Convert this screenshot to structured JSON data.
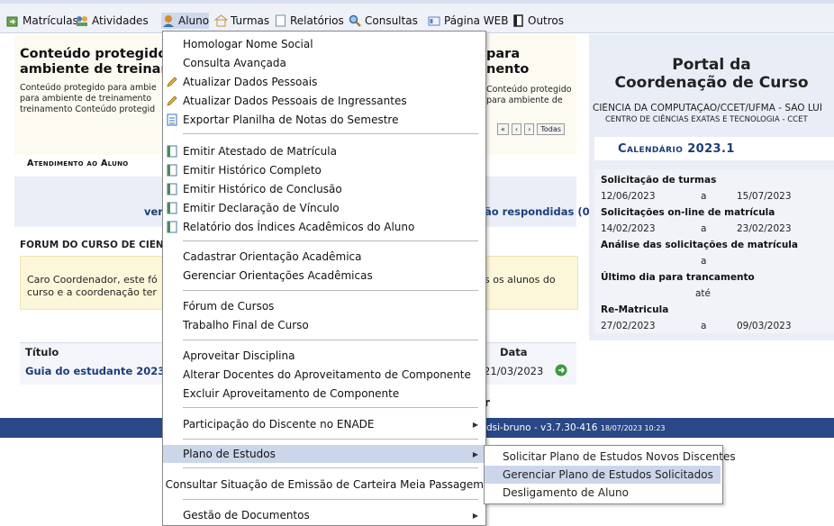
{
  "menubar": {
    "items": [
      {
        "label": "Matrículas",
        "icon": "matriculas-icon"
      },
      {
        "label": "Atividades",
        "icon": "atividades-icon"
      },
      {
        "label": "Aluno",
        "icon": "aluno-icon"
      },
      {
        "label": "Turmas",
        "icon": "turmas-icon"
      },
      {
        "label": "Relatórios",
        "icon": "relatorios-icon"
      },
      {
        "label": "Consultas",
        "icon": "search-icon"
      },
      {
        "label": "Página WEB",
        "icon": "web-icon"
      },
      {
        "label": "Outros",
        "icon": "outros-icon"
      }
    ]
  },
  "left": {
    "title_line1": "Conteúdo protegido p",
    "title_line1_right": "para",
    "title_line2": "ambiente de treiname",
    "title_line2_right": "nento",
    "body_line1": "Conteúdo protegido para ambie",
    "body_line1_right": "Conteúdo protegido",
    "body_line2": "para ambiente de treinamento",
    "body_line2_right": "para ambiente de",
    "body_line3": "treinamento Conteúdo protegid",
    "pager": [
      "«",
      "‹",
      "›",
      "Todas"
    ],
    "atendimento_title": "Atendimento ao Aluno",
    "ver_text": "ver",
    "nao_respondidas": "ão respondidas (0)",
    "forum_title": "FÓRUM DO CURSO DE CIÊN",
    "forum_msg_line1": "Caro Coordenador, este fó",
    "forum_msg_line1_right": "s os alunos do",
    "forum_msg_line2": "curso e a coordenação ter",
    "table": {
      "col_titulo": "Título",
      "col_data": "Data",
      "row_titulo": "Guia do estudante 2023",
      "row_data": "21/03/2023"
    },
    "footer_r": "r",
    "footer_text": "dsi-bruno - v3.7.30-416",
    "footer_date": "18/07/2023 10:23"
  },
  "menu": {
    "items": [
      {
        "label": "Homologar Nome Social",
        "icon": ""
      },
      {
        "label": "Consulta Avançada",
        "icon": ""
      },
      {
        "label": "Atualizar Dados Pessoais",
        "icon": "pencil-icon"
      },
      {
        "label": "Atualizar Dados Pessoais de Ingressantes",
        "icon": "pencil-icon"
      },
      {
        "label": "Exportar Planilha de Notas do Semestre",
        "icon": "spreadsheet-icon"
      },
      {
        "label": "Emitir Atestado de Matrícula",
        "icon": "document-icon"
      },
      {
        "label": "Emitir Histórico Completo",
        "icon": "document-icon"
      },
      {
        "label": "Emitir Histórico de Conclusão",
        "icon": "document-icon"
      },
      {
        "label": "Emitir Declaração de Vínculo",
        "icon": "document-icon"
      },
      {
        "label": "Relatório dos Índices Acadêmicos do Aluno",
        "icon": "document-icon"
      },
      {
        "label": "Cadastrar Orientação Acadêmica",
        "icon": ""
      },
      {
        "label": "Gerenciar Orientações Acadêmicas",
        "icon": ""
      },
      {
        "label": "Fórum de Cursos",
        "icon": ""
      },
      {
        "label": "Trabalho Final de Curso",
        "icon": ""
      },
      {
        "label": "Aproveitar Disciplina",
        "icon": ""
      },
      {
        "label": "Alterar Docentes do Aproveitamento de Componente",
        "icon": ""
      },
      {
        "label": "Excluir Aproveitamento de Componente",
        "icon": ""
      },
      {
        "label": "Participação do Discente no ENADE",
        "icon": ""
      },
      {
        "label": "Plano de Estudos",
        "icon": ""
      },
      {
        "label": "Consultar Situação de Emissão de Carteira Meia Passagem",
        "icon": ""
      },
      {
        "label": "Gestão de Documentos",
        "icon": ""
      }
    ]
  },
  "submenu": {
    "items": [
      {
        "label": "Solicitar Plano de Estudos Novos Discentes"
      },
      {
        "label": "Gerenciar Plano de Estudos Solicitados"
      },
      {
        "label": "Desligamento de Aluno"
      }
    ]
  },
  "portal": {
    "title_line1": "Portal da",
    "title_line2": "Coordenação de Curso",
    "course": "CIÊNCIA DA COMPUTAÇÃO/CCET/UFMA - SÃO LUÍ",
    "center": "CENTRO DE CIÊNCIAS EXATAS E TECNOLOGIA - CCET",
    "calendar_title": "Calendário 2023.1",
    "calendar": [
      {
        "label": "Solicitação de turmas",
        "start": "12/06/2023",
        "sep": "a",
        "end": "15/07/2023"
      },
      {
        "label": "Solicitações on-line de matrícula",
        "start": "14/02/2023",
        "sep": "a",
        "end": "23/02/2023"
      },
      {
        "label": "Análise das solicitações de matrícula",
        "start": "",
        "sep": "a",
        "end": ""
      },
      {
        "label": "Último dia para trancamento",
        "start": "",
        "sep": "até",
        "end": ""
      },
      {
        "label": "Re-Matricula",
        "start": "27/02/2023",
        "sep": "a",
        "end": "09/03/2023"
      }
    ]
  },
  "colors": {
    "menubar_bg": "#eef1f7",
    "highlight": "#ccd6ea",
    "footer_bg": "#2a4787",
    "portal_bg": "#e9edf6",
    "link_blue": "#1c3d7a"
  }
}
